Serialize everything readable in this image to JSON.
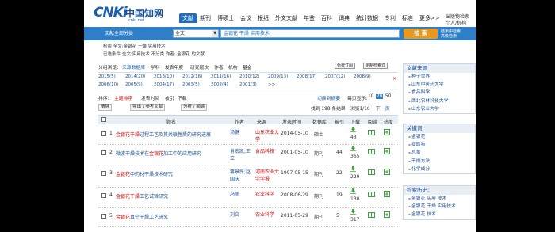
{
  "header": {
    "logo_text": "CNKi",
    "logo_cn": "中国知网",
    "logo_url": "cnki.net",
    "nav": [
      "文献",
      "期刊",
      "博硕士",
      "会议",
      "报纸",
      "外文文献",
      "年鉴",
      "百科",
      "词典",
      "统计数据",
      "专利",
      "标准",
      "更多>>"
    ],
    "right_links": [
      "出版物检索",
      "个人/机构"
    ]
  },
  "search": {
    "category": "文献全部分类",
    "field": "全文",
    "query": "金银花 干燥 实用技术",
    "button": "检 索",
    "adv_links": [
      "结果中检索",
      "高级检索"
    ]
  },
  "hint1": "检索  全文:金银花 干燥 实用技术",
  "hint2": "已选条件:全文:实用技术 不分类 作者: 金银花 的文献",
  "controls": {
    "group_label": "分组浏览:",
    "group_tabs": [
      "来源数据库",
      "学科",
      "发表年度",
      "研究层次",
      "作者",
      "机构",
      "基金"
    ],
    "free_tag": "免费订阅",
    "export_tag": "定制检索式",
    "years": [
      "2015(5)",
      "2014(20)",
      "2013(10)",
      "2012(16)",
      "2011(16)",
      "2010(12)",
      "2009(13)",
      "2008(17)",
      "2007(12)",
      "2008(9)",
      "2006(10)",
      "2005(9)",
      "2004(17)",
      "2003(5)",
      "2002(4)",
      "2001(3)",
      ">>"
    ],
    "close": "×",
    "sort_label": "排序:",
    "sort_items": [
      "主题排序",
      "发表时间",
      "被引",
      "下载"
    ],
    "view_toggle": "切换到摘要",
    "per_page_label": "每页显示:",
    "per_page": [
      "10",
      "20",
      "50"
    ],
    "tools": [
      "清除",
      "导出 / 参考文献",
      "分析 / 阅读"
    ],
    "count_text": "找到 198 条结果",
    "pager": "浏览1/10",
    "next": "下一页"
  },
  "table": {
    "headers": [
      "",
      "题名",
      "作者",
      "来源",
      "发表时间",
      "数据库",
      "被引",
      "下载",
      "阅读",
      "热度"
    ],
    "rows": [
      {
        "num": "1",
        "title_pre": "",
        "title_hl": "金银花干燥",
        "title_post": "过程工艺及其关联性质的研究进展",
        "author": "汤健",
        "source": "山东农业大学",
        "date": "2014-05-10",
        "db": "硕士",
        "cited": "",
        "down": "43"
      },
      {
        "num": "2",
        "title_pre": "微波干燥技术在",
        "title_hl": "金银花",
        "title_post": "加工中的应用研究",
        "author": "肖宏凯;王立",
        "source": "食品科技",
        "date": "2001-05-10",
        "db": "期刊",
        "cited": "44",
        "down": "365"
      },
      {
        "num": "3",
        "title_pre": "",
        "title_hl": "金银花",
        "title_post": "中药材干燥技术研究",
        "author": "蒋景民;赵国庆",
        "source": "河南农业大学学报",
        "date": "1997-05-15",
        "db": "期刊",
        "cited": "22",
        "down": "229"
      },
      {
        "num": "4",
        "title_pre": "",
        "title_hl": "金银花干燥",
        "title_post": "工艺试验研究",
        "author": "冯丽",
        "source": "农业科学",
        "date": "2008-06-29",
        "db": "期刊",
        "cited": "19",
        "down": "130"
      },
      {
        "num": "5",
        "title_pre": "",
        "title_hl": "金银花",
        "title_post": "真空干燥工艺研究",
        "author": "刘文",
        "source": "农业科学",
        "date": "2011-05-29",
        "db": "期刊",
        "cited": "5",
        "down": "317"
      }
    ]
  },
  "sidebar": {
    "sections": [
      {
        "title": "文献来源",
        "items": [
          "种子世界",
          "山东中医药大学",
          "食品科学",
          "西北农林科技大学",
          "山东农业大学"
        ]
      },
      {
        "title": "关键词",
        "items": [
          "金银花",
          "提取物",
          "总黄",
          "干燥方法",
          "化学成分"
        ]
      },
      {
        "title": "检索历史:",
        "items": [
          "金银花 实用 技术",
          "金银花 干燥 实用技术",
          "金银花 技术"
        ]
      }
    ]
  }
}
